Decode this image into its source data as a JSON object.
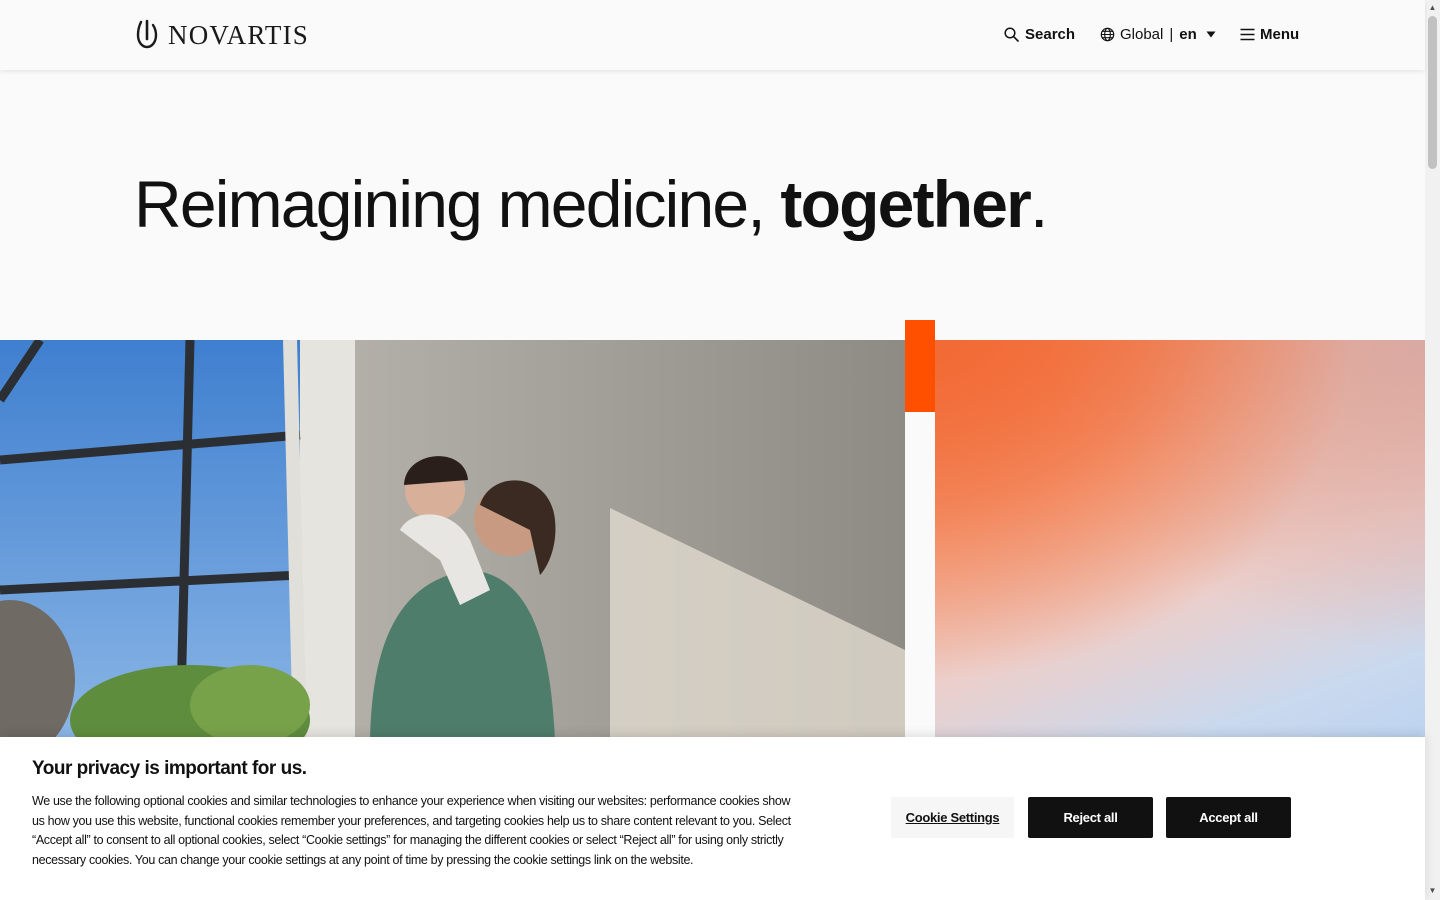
{
  "header": {
    "logo_text": "NOVARTIS",
    "search_label": "Search",
    "region_label": "Global",
    "region_separator": "|",
    "language_code": "en",
    "menu_label": "Menu"
  },
  "hero": {
    "title_regular": "Reimagining medicine,",
    "title_bold": "together",
    "title_end": "."
  },
  "cookie_banner": {
    "title": "Your privacy is important for us.",
    "body": "We use the following optional cookies and similar technologies to enhance your experience when visiting our websites: performance cookies show us how you use this website, functional cookies remember your preferences, and targeting cookies help us to share content relevant to you. Select “Accept all” to consent to all optional cookies, select “Cookie settings” for managing the different cookies or select “Reject all” for using only strictly necessary cookies. You can change your cookie settings at any point of time by pressing the cookie settings link on the website.",
    "settings_label": "Cookie Settings",
    "reject_label": "Reject all",
    "accept_label": "Accept all"
  },
  "icons": {
    "search": "search-icon",
    "globe": "globe-icon",
    "caret": "caret-down-icon",
    "menu": "hamburger-icon"
  },
  "colors": {
    "accent": "#ff5000",
    "text": "#111111",
    "button_dark": "#111111",
    "background": "#fafafa"
  }
}
